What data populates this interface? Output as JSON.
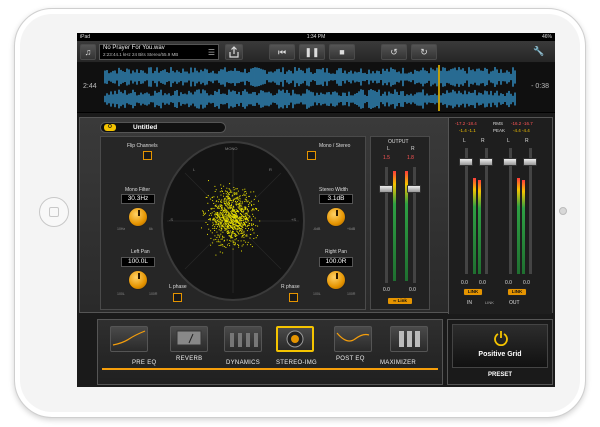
{
  "status_bar": {
    "device": "iPad",
    "time": "1:34 PM",
    "battery": "46%"
  },
  "file": {
    "name": "No Prayer For You.wav",
    "info": "2:23:44.1 kHz 24 Bits Stereo/55.9 MB"
  },
  "transport": {
    "elapsed": "2:44",
    "remaining": "- 0:38"
  },
  "preset": {
    "toggle_label": "O",
    "name": "Untitled"
  },
  "imager": {
    "flip_channels": "Flip Channels",
    "mono_stereo": "Mono / Stereo",
    "mono_label": "MONO",
    "l_label": "L",
    "r_label": "R",
    "plus_s": "+S",
    "minus_s": "-S",
    "mono_filter_label": "Mono Filter",
    "mono_filter_value": "30.3Hz",
    "mono_filter_min": "10Hz",
    "mono_filter_max": "6k",
    "stereo_width_label": "Stereo Width",
    "stereo_width_value": "3.1dB",
    "stereo_width_min": "-6dB",
    "stereo_width_max": "+6dB",
    "left_pan_label": "Left Pan",
    "left_pan_value": "100.0L",
    "left_pan_min": "100L",
    "left_pan_max": "100R",
    "right_pan_label": "Right Pan",
    "right_pan_value": "100.0R",
    "right_pan_min": "100L",
    "right_pan_max": "100R",
    "l_phase": "L phase",
    "r_phase": "R phase",
    "points_color": "#e8e000"
  },
  "output": {
    "title": "OUTPUT",
    "l": "L",
    "r": "R",
    "peak_l": "1.5",
    "peak_r": "1.8",
    "value_l": "0.0",
    "value_r": "0.0",
    "link_label": "Link"
  },
  "meters": {
    "top_left": "-17.2 -18.4",
    "top_right": "-16.2 -16.7",
    "rms_label": "RMS",
    "peak_left": "-1.4 -1.1",
    "peak_right": "-4.4 -4.4",
    "peak_label": "PEAK",
    "in_l": "L",
    "in_r": "R",
    "out_l": "L",
    "out_r": "R",
    "in_val_l": "0.0",
    "in_val_r": "0.0",
    "out_val_l": "0.0",
    "out_val_r": "0.0",
    "link_label": "LINK",
    "in_label": "IN",
    "out_label": "OUT"
  },
  "chain": {
    "pre_eq": "PRE EQ",
    "reverb": "REVERB",
    "dynamics": "DYNAMICS",
    "stereo_img": "STEREO-IMG",
    "post_eq": "POST EQ",
    "maximizer": "MAXIMIZER"
  },
  "brand": {
    "name": "Positive Grid",
    "preset_label": "PRESET"
  },
  "colors": {
    "accent": "#f5c400",
    "knob": "#e59400",
    "wave": "#3aa8e8"
  }
}
